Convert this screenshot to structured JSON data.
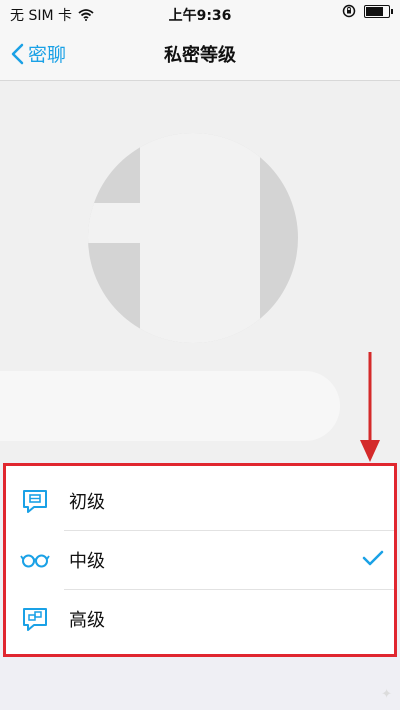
{
  "status_bar": {
    "carrier": "无 SIM 卡",
    "time": "上午9:36",
    "battery_level": 0.85
  },
  "nav": {
    "back_label": "密聊",
    "title": "私密等级"
  },
  "levels": [
    {
      "label": "初级",
      "icon": "chat-bubble-icon",
      "selected": false
    },
    {
      "label": "中级",
      "icon": "glasses-icon",
      "selected": true
    },
    {
      "label": "高级",
      "icon": "link-chat-icon",
      "selected": false
    }
  ],
  "colors": {
    "accent": "#1aa1e6",
    "highlight_border": "#e0262f",
    "annotation_arrow": "#d42a2a"
  }
}
